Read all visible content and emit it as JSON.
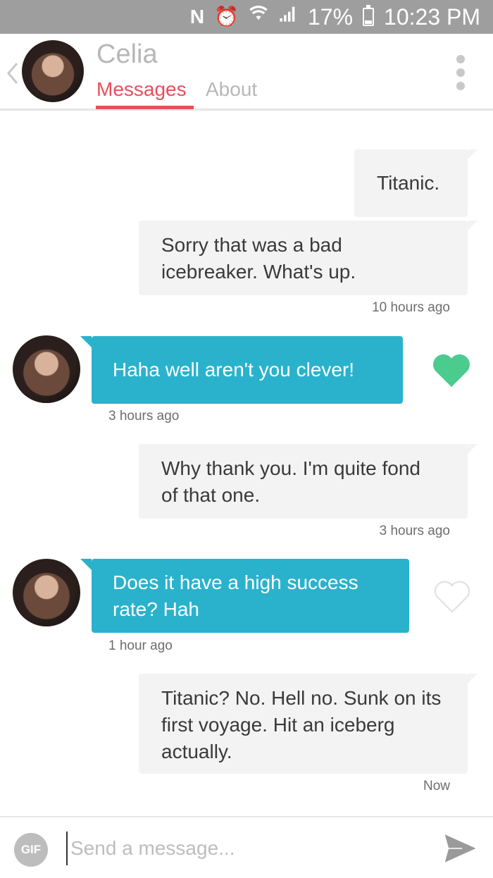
{
  "status_bar": {
    "battery": "17%",
    "time": "10:23 PM",
    "icons": [
      "nfc-icon",
      "alarm-icon",
      "wifi-icon",
      "signal-icon",
      "battery-icon"
    ]
  },
  "header": {
    "contact_name": "Celia",
    "tabs": [
      {
        "label": "Messages",
        "active": true
      },
      {
        "label": "About",
        "active": false
      }
    ]
  },
  "messages": [
    {
      "direction": "outgoing",
      "text": "Titanic."
    },
    {
      "direction": "outgoing",
      "text": "Sorry that was a bad icebreaker. What's up.",
      "time": "10 hours ago"
    },
    {
      "direction": "incoming",
      "text": "Haha well aren't you clever!",
      "time": "3 hours ago",
      "liked": true
    },
    {
      "direction": "outgoing",
      "text": "Why thank you. I'm quite fond of that one.",
      "time": "3 hours ago"
    },
    {
      "direction": "incoming",
      "text": "Does it have a high success rate? Hah",
      "time": "1 hour ago",
      "liked": false
    },
    {
      "direction": "outgoing",
      "text": "Titanic? No. Hell no. Sunk on its first voyage. Hit an iceberg actually.",
      "time": "Now"
    }
  ],
  "composer": {
    "gif_label": "GIF",
    "placeholder": "Send a message..."
  },
  "colors": {
    "accent": "#ea4e5a",
    "incoming_bubble": "#2ab2cc",
    "outgoing_bubble": "#f3f3f3",
    "like_heart": "#4ccb8f",
    "status_bar": "#9e9e9e"
  }
}
